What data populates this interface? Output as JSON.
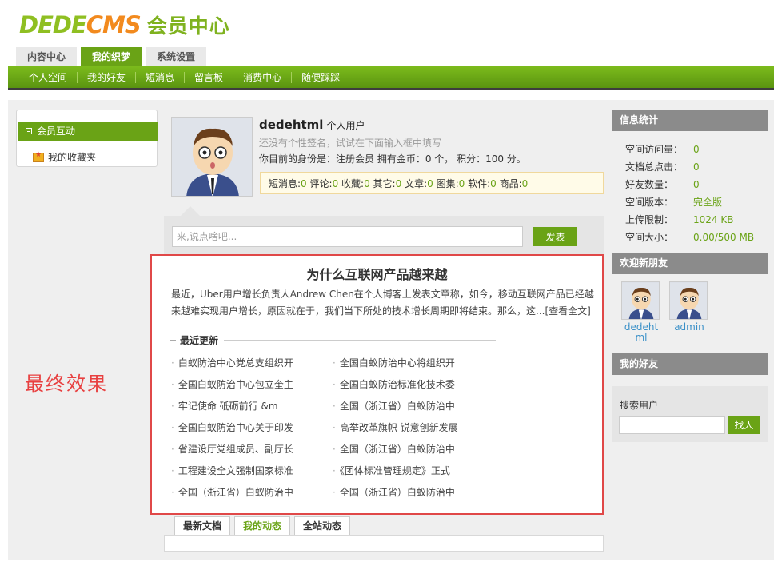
{
  "logo": {
    "brand_a": "DEDE",
    "brand_b": "CMS",
    "subtitle": "会员中心"
  },
  "top_tabs": [
    {
      "label": "内容中心",
      "active": false
    },
    {
      "label": "我的织梦",
      "active": true
    },
    {
      "label": "系统设置",
      "active": false
    }
  ],
  "nav": [
    "个人空间",
    "我的好友",
    "短消息",
    "留言板",
    "消费中心",
    "随便踩踩"
  ],
  "left_sidebar": {
    "section": "会员互动",
    "item": "我的收藏夹"
  },
  "overlay_label": "最终效果",
  "profile": {
    "username": "dedehtml",
    "user_type": "个人用户",
    "signature": "还没有个性签名，试试在下面输入框中填写",
    "identity": "你目前的身份是：注册会员 拥有金币：0 个， 积分：100 分。",
    "stats": [
      {
        "label": "短消息:",
        "value": "0"
      },
      {
        "label": "评论:",
        "value": "0"
      },
      {
        "label": "收藏:",
        "value": "0"
      },
      {
        "label": "其它:",
        "value": "0"
      },
      {
        "label": "文章:",
        "value": "0"
      },
      {
        "label": "图集:",
        "value": "0"
      },
      {
        "label": "软件:",
        "value": "0"
      },
      {
        "label": "商品:",
        "value": "0"
      }
    ]
  },
  "post": {
    "placeholder": "来,说点啥吧...",
    "button": "发表"
  },
  "article": {
    "title": "为什么互联网产品越来越",
    "summary": "最近，Uber用户增长负责人Andrew Chen在个人博客上发表文章称，如今，移动互联网产品已经越来越难实现用户增长，原因就在于，我们当下所处的技术增长周期即将结束。那么，这...",
    "more": "[查看全文]",
    "recent_title": "最近更新",
    "recent": [
      "白蚁防治中心党总支组织开",
      "全国白蚁防治中心将组织开",
      "全国白蚁防治中心包立奎主",
      "全国白蚁防治标准化技术委",
      "牢记使命 砥砺前行 &m",
      "全国（浙江省）白蚁防治中",
      "全国白蚁防治中心关于印发",
      "高举改革旗帜 锐意创新发展",
      "省建设厅党组成员、副厅长",
      "全国（浙江省）白蚁防治中",
      "工程建设全文强制国家标准",
      "《团体标准管理规定》正式",
      "全国（浙江省）白蚁防治中",
      "全国（浙江省）白蚁防治中"
    ]
  },
  "bottom_tabs": [
    {
      "label": "最新文档",
      "active": false
    },
    {
      "label": "我的动态",
      "active": true
    },
    {
      "label": "全站动态",
      "active": false
    }
  ],
  "right_sidebar": {
    "info_title": "信息统计",
    "info": [
      {
        "k": "空间访问量：",
        "v": "0"
      },
      {
        "k": "文档总点击：",
        "v": "0"
      },
      {
        "k": "好友数量：",
        "v": "0"
      },
      {
        "k": "空间版本：",
        "v": "完全版"
      },
      {
        "k": "上传限制：",
        "v": "1024 KB"
      },
      {
        "k": "空间大小：",
        "v": "0.00/500 MB"
      }
    ],
    "welcome_title": "欢迎新朋友",
    "new_friends": [
      "dedehtml",
      "admin"
    ],
    "friends_title": "我的好友",
    "search_label": "搜索用户",
    "search_button": "找人"
  }
}
